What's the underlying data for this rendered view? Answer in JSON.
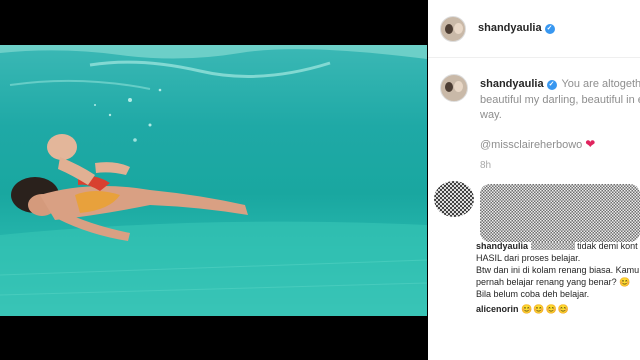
{
  "post": {
    "username": "shandyaulia",
    "caption_line1": "You are altogether",
    "caption_line2": "beautiful my darling, beautiful in every",
    "caption_line3": "way.",
    "mention": "@missclaireherbowo",
    "heart": "❤",
    "time": "8h"
  },
  "reply": {
    "username": "shandyaulia",
    "line1_rest": "tidak demi kont",
    "line2": "HASIL dari proses belajar.",
    "line3": "Btw dan ini di kolam renang biasa. Kamu s",
    "line4": "pernah belajar renang yang benar? 😊",
    "line5": "Bila belum coba deh belajar."
  },
  "comment2": {
    "username": "alicenorin",
    "emojis": "😊😊😊😊"
  },
  "controls": {
    "volume_icon": "🔈"
  },
  "colors": {
    "verified": "#3897f0",
    "heart": "#e0245e",
    "water": "#1fa9a6"
  }
}
